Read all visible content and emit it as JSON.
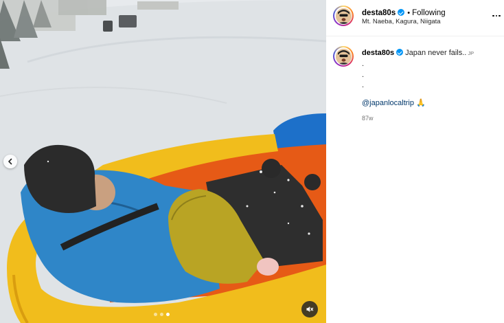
{
  "post": {
    "author": "desta80s",
    "follow_status": "Following",
    "separator": "•",
    "location": "Mt. Naeba, Kagura, Niigata",
    "verified": true
  },
  "caption": {
    "username": "desta80s",
    "text": "Japan never fails..",
    "language_tag": "JP",
    "dot_lines": [
      ".",
      ".",
      "."
    ],
    "mention": "@japanlocaltrip",
    "emoji": "🙏",
    "time_ago": "87w"
  },
  "carousel": {
    "total_slides": 3,
    "active_slide": 3
  },
  "media": {
    "audio": "muted"
  },
  "colors": {
    "verified_badge": "#0095f6",
    "mention_link": "#00376b",
    "secondary_text": "#737373"
  },
  "icons": {
    "prev": "chevron-left-icon",
    "mute": "speaker-muted-icon",
    "more": "more-horizontal-icon",
    "verified": "verified-badge-icon"
  }
}
